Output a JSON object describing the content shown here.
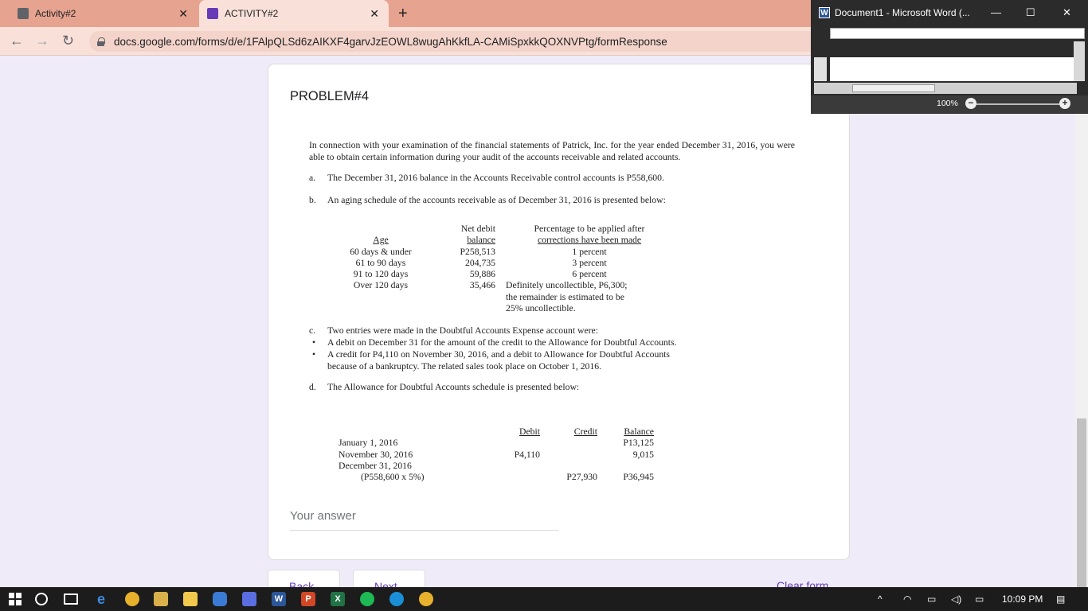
{
  "browser": {
    "tabs": [
      {
        "label": "Activity#2",
        "icon": "slides-icon",
        "color": "#5f6368"
      },
      {
        "label": "ACTIVITY#2",
        "icon": "forms-icon",
        "color": "#673ab7"
      }
    ],
    "close_glyph": "✕",
    "new_tab_glyph": "+",
    "url": "docs.google.com/forms/d/e/1FAlpQLSd6zAIKXF4garvJzEOWL8wugAhKkfLA-CAMiSpxkkQOXNVPtg/formResponse"
  },
  "word_window": {
    "title": "Document1 - Microsoft Word (...",
    "logo": "W",
    "zoom": "100%"
  },
  "form": {
    "question_title": "PROBLEM#4",
    "intro": "In connection with your examination of the financial statements of Patrick, Inc. for the year ended December 31, 2016, you were able to obtain certain information during your audit of the accounts receivable and related accounts.",
    "item_a": {
      "label": "a.",
      "text": "The December 31, 2016 balance in the Accounts Receivable control accounts is P558,600."
    },
    "item_b": {
      "label": "b.",
      "text": "An aging schedule of the accounts receivable as of December 31, 2016 is presented below:"
    },
    "aging_table": {
      "headers": {
        "age": "Age",
        "balance_line1": "Net debit",
        "balance_line2": "balance",
        "pct_line1": "Percentage to be applied after",
        "pct_line2": "corrections have been made"
      },
      "rows": [
        {
          "age": "60 days & under",
          "balance": "P258,513",
          "pct": "1 percent"
        },
        {
          "age": "61 to 90 days",
          "balance": "204,735",
          "pct": "3 percent"
        },
        {
          "age": "91 to 120 days",
          "balance": "59,886",
          "pct": "6 percent"
        },
        {
          "age": "Over 120 days",
          "balance": "35,466",
          "pct": "Definitely uncollectible, P6,300;"
        }
      ],
      "note_line2": "the remainder is estimated to be",
      "note_line3": "25% uncollectible."
    },
    "item_c": {
      "label": "c.",
      "text": "Two entries were made in the Doubtful Accounts Expense account were:",
      "bullets": [
        "A debit on December 31 for the amount of the credit to the Allowance for Doubtful Accounts.",
        "A credit for P4,110 on November 30, 2016, and a debit to Allowance for Doubtful Accounts",
        "because of a bankruptcy. The related sales took place on October 1, 2016."
      ]
    },
    "item_d": {
      "label": "d.",
      "text": "The Allowance for Doubtful Accounts schedule is presented below:"
    },
    "allowance_table": {
      "headers": {
        "debit": "Debit",
        "credit": "Credit",
        "balance": "Balance"
      },
      "rows": [
        {
          "date": "January 1, 2016",
          "debit": "",
          "credit": "",
          "balance": "P13,125"
        },
        {
          "date": "November 30, 2016",
          "debit": "P4,110",
          "credit": "",
          "balance": "9,015"
        },
        {
          "date": "December 31, 2016",
          "debit": "",
          "credit": "",
          "balance": ""
        },
        {
          "date": "(P558,600 x 5%)",
          "debit": "",
          "credit": "P27,930",
          "balance": "P36,945"
        }
      ]
    },
    "answer_placeholder": "Your answer",
    "back_label": "Back",
    "next_label": "Next",
    "clear_label": "Clear form"
  },
  "taskbar": {
    "time": "10:09 PM"
  }
}
